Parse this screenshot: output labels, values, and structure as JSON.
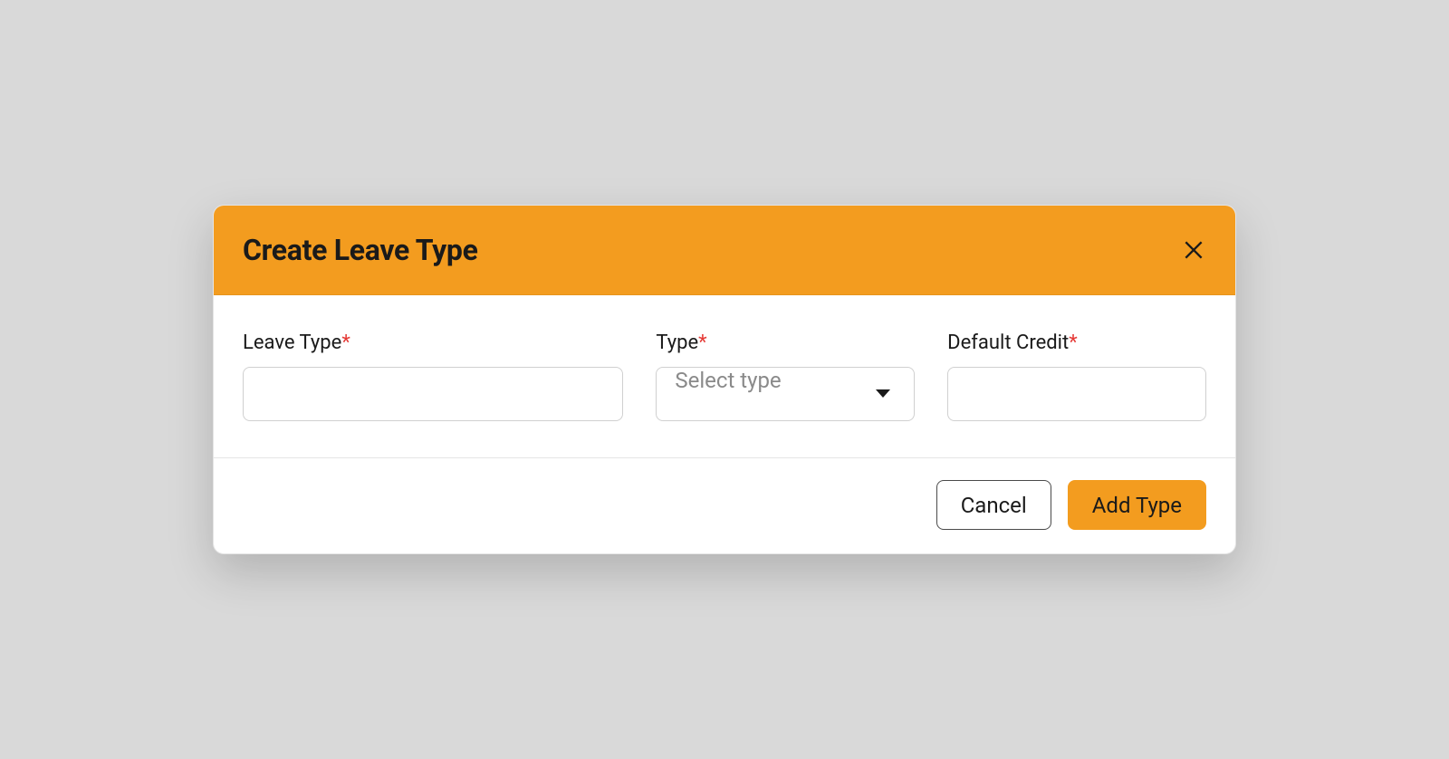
{
  "modal": {
    "title": "Create Leave Type",
    "fields": {
      "leave_type": {
        "label": "Leave Type",
        "value": ""
      },
      "type": {
        "label": "Type",
        "placeholder": "Select type"
      },
      "default_credit": {
        "label": "Default Credit",
        "value": ""
      }
    },
    "buttons": {
      "cancel": "Cancel",
      "submit": "Add Type"
    }
  },
  "colors": {
    "accent": "#f39c1f",
    "required": "#e53935"
  }
}
